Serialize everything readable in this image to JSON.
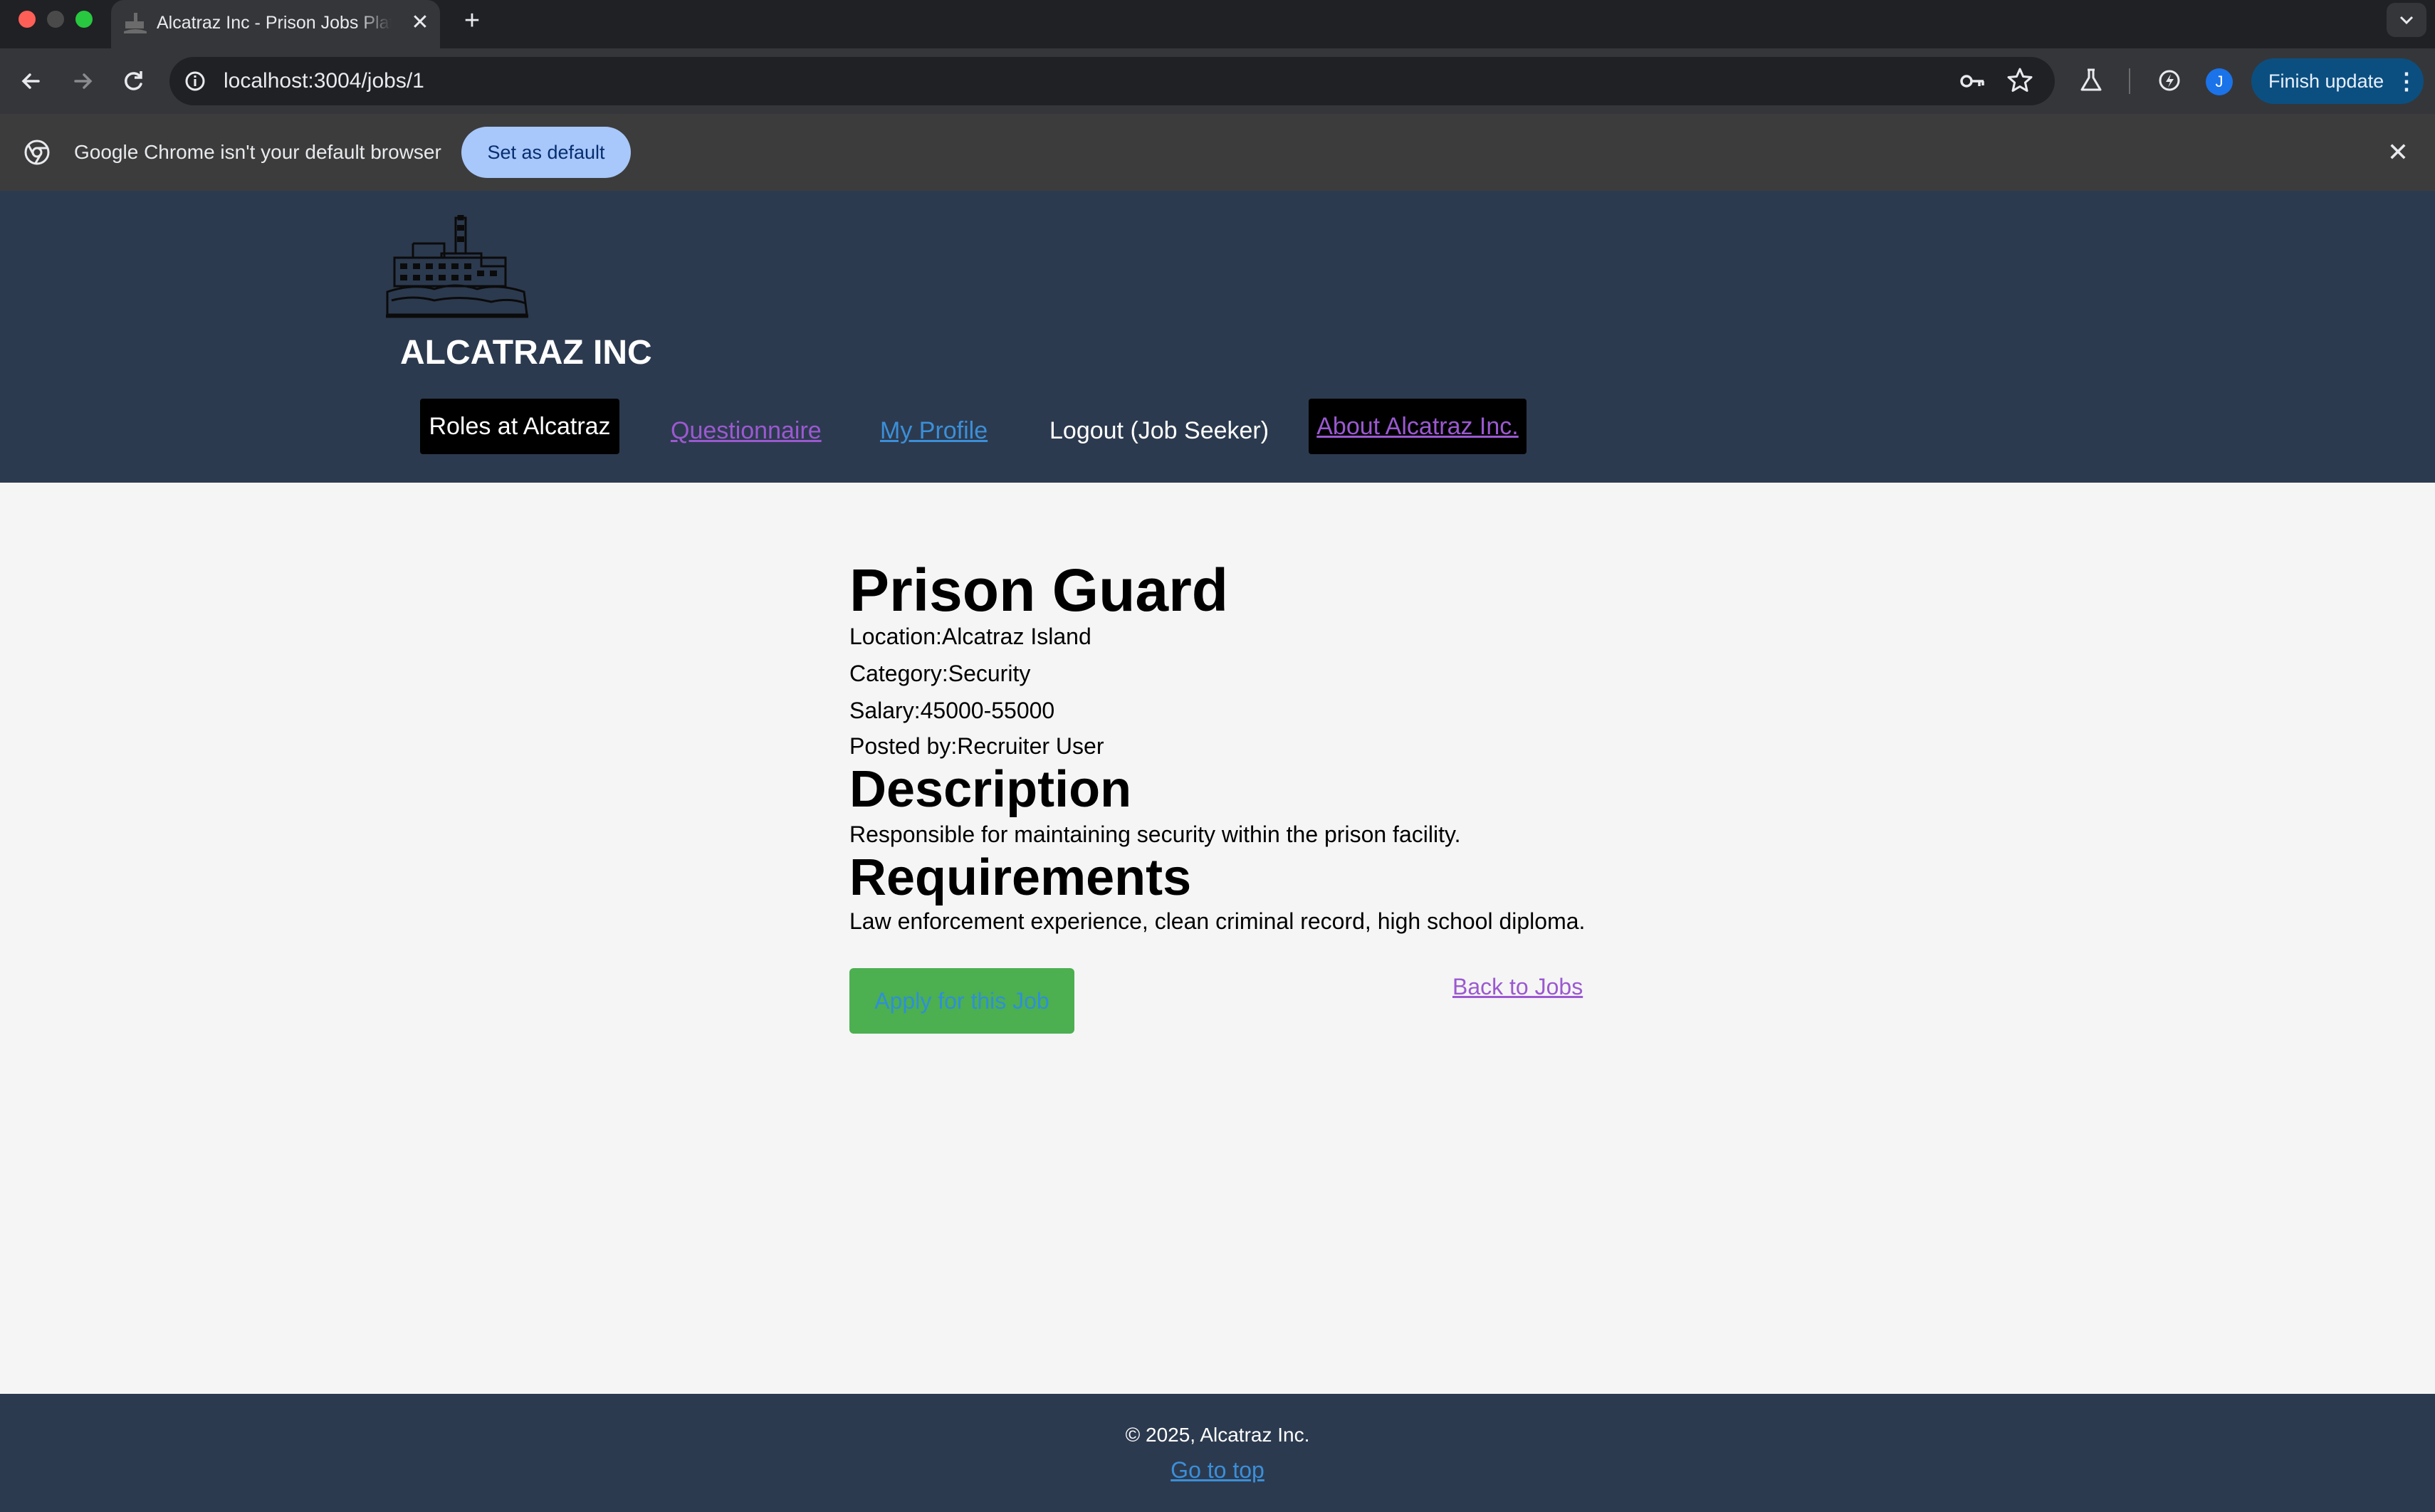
{
  "browser": {
    "tab_title": "Alcatraz Inc - Prison Jobs Platform",
    "tab_close": "✕",
    "new_tab": "+",
    "url": "localhost:3004/jobs/1",
    "finish_update": "Finish update",
    "avatar_letter": "J",
    "infobar_text": "Google Chrome isn't your default browser",
    "set_default": "Set as default",
    "infobar_close": "✕",
    "icons": [
      "back-arrow-icon",
      "forward-arrow-icon",
      "reload-icon",
      "site-info-icon",
      "password-key-icon",
      "bookmark-star-icon",
      "labs-flask-icon",
      "performance-icon",
      "chevron-down-icon"
    ]
  },
  "site": {
    "brand": "ALCATRAZ INC",
    "nav": {
      "roles": "Roles at Alcatraz",
      "questionnaire": "Questionnaire",
      "profile": "My Profile",
      "logout": "Logout (Job Seeker)",
      "about": "About Alcatraz Inc."
    }
  },
  "job": {
    "title": "Prison Guard",
    "location": "Location:Alcatraz Island",
    "category": "Category:Security",
    "salary": "Salary:45000-55000",
    "posted_by": "Posted by:Recruiter User",
    "description_heading": "Description",
    "description": "Responsible for maintaining security within the prison facility.",
    "requirements_heading": "Requirements",
    "requirements": "Law enforcement experience, clean criminal record, high school diploma.",
    "apply_label": "Apply for this Job",
    "back_label": "Back to Jobs"
  },
  "footer": {
    "copyright": "© 2025, Alcatraz Inc.",
    "go_top": "Go to top"
  },
  "colors": {
    "header_bg": "#2c3a4f",
    "page_bg": "#f5f5f5",
    "apply_green": "#4caf50",
    "link_purple": "#9b59d0",
    "link_blue": "#3b8fd8"
  }
}
